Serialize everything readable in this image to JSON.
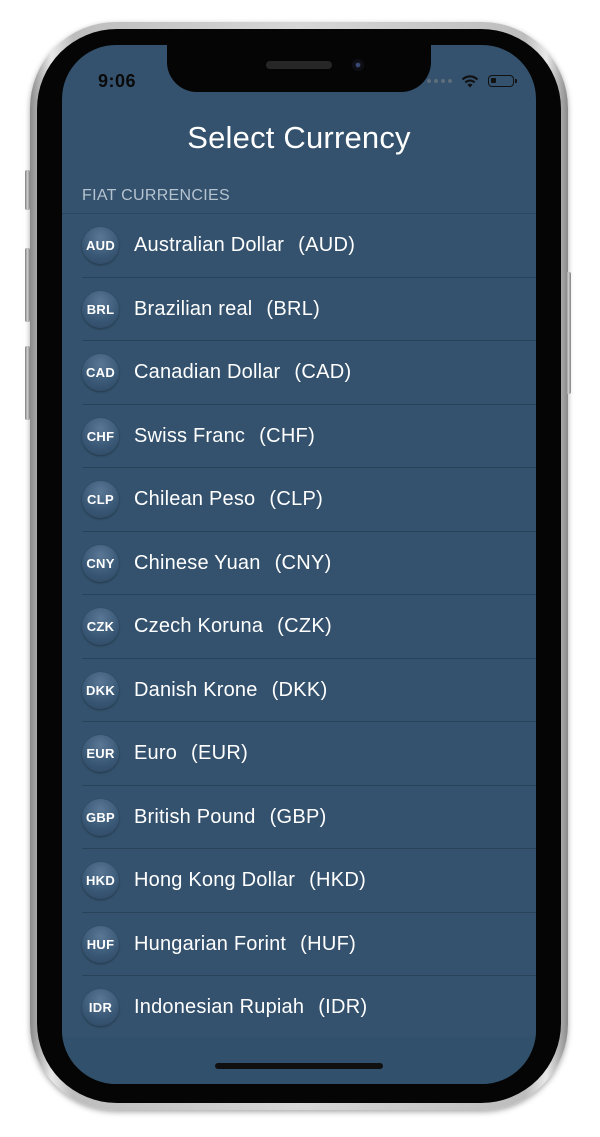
{
  "status_bar": {
    "time": "9:06",
    "battery_level": 0.25
  },
  "icons": {
    "signal": "cellular-signal-icon",
    "wifi": "wifi-icon",
    "battery": "battery-icon"
  },
  "title": "Select Currency",
  "section": {
    "header": "FIAT CURRENCIES"
  },
  "currencies": [
    {
      "badge": "AUD",
      "name": "Australian Dollar",
      "code": "(AUD)"
    },
    {
      "badge": "BRL",
      "name": "Brazilian real",
      "code": "(BRL)"
    },
    {
      "badge": "CAD",
      "name": "Canadian Dollar",
      "code": "(CAD)"
    },
    {
      "badge": "CHF",
      "name": "Swiss Franc",
      "code": "(CHF)"
    },
    {
      "badge": "CLP",
      "name": "Chilean Peso",
      "code": "(CLP)"
    },
    {
      "badge": "CNY",
      "name": "Chinese Yuan",
      "code": "(CNY)"
    },
    {
      "badge": "CZK",
      "name": "Czech Koruna",
      "code": "(CZK)"
    },
    {
      "badge": "DKK",
      "name": "Danish Krone",
      "code": "(DKK)"
    },
    {
      "badge": "EUR",
      "name": "Euro",
      "code": "(EUR)"
    },
    {
      "badge": "GBP",
      "name": "British Pound",
      "code": "(GBP)"
    },
    {
      "badge": "HKD",
      "name": "Hong Kong Dollar",
      "code": "(HKD)"
    },
    {
      "badge": "HUF",
      "name": "Hungarian Forint",
      "code": "(HUF)"
    },
    {
      "badge": "IDR",
      "name": "Indonesian Rupiah",
      "code": "(IDR)"
    }
  ],
  "colors": {
    "background": "#34526d",
    "separator": "#284259",
    "text": "#ffffff",
    "section_header": "#b5c3d0"
  }
}
